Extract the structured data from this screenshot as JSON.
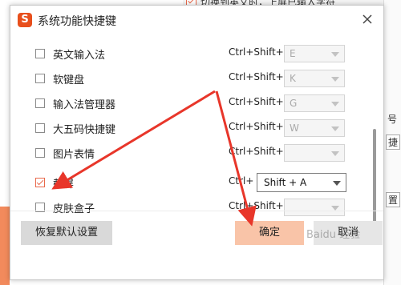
{
  "background": {
    "top_text": "切换到英文时，上屏已输入字符",
    "right_fragments": [
      "号",
      "捷",
      "置"
    ]
  },
  "dialog": {
    "logo": "S",
    "title": "系统功能快捷键"
  },
  "rows": [
    {
      "label": "英文输入法",
      "checked": false,
      "modifier": "Ctrl+Shift+",
      "key": "E",
      "active": false
    },
    {
      "label": "软键盘",
      "checked": false,
      "modifier": "Ctrl+Shift+",
      "key": "K",
      "active": false
    },
    {
      "label": "输入法管理器",
      "checked": false,
      "modifier": "Ctrl+Shift+",
      "key": "G",
      "active": false
    },
    {
      "label": "大五码快捷键",
      "checked": false,
      "modifier": "Ctrl+Shift+",
      "key": "W",
      "active": false
    },
    {
      "label": "图片表情",
      "checked": false,
      "modifier": "Ctrl+Shift+",
      "key": "",
      "active": false
    },
    {
      "label": "截屏",
      "checked": true,
      "modifier": "Ctrl+",
      "key": "Shift + A",
      "active": true
    },
    {
      "label": "皮肤盒子",
      "checked": false,
      "modifier": "Ctrl+Shift+",
      "key": "",
      "active": false
    }
  ],
  "buttons": {
    "reset": "恢复默认设置",
    "ok": "确定",
    "cancel": "取消"
  },
  "watermark": "Baidu 经验",
  "colors": {
    "accent": "#e8684a",
    "logo": "#e84f1c",
    "ok_button": "#f9c4a8",
    "arrow": "#e8362a"
  }
}
